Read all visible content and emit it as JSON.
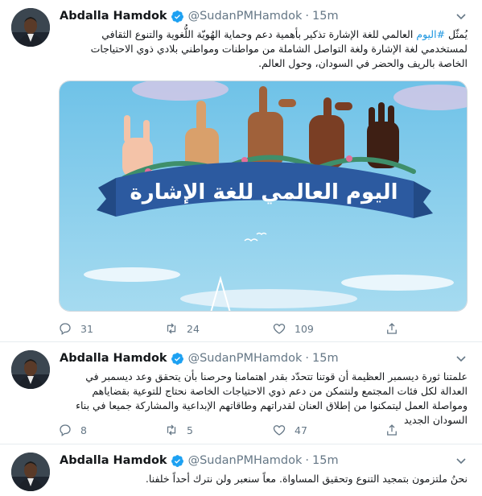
{
  "tweets": [
    {
      "author": "Abdalla Hamdok",
      "handle": "@SudanPMHamdok",
      "separator": "·",
      "time": "15m",
      "hashtag": "#اليوم",
      "text_before": "يُمثّل",
      "text_after": "العالمي للغة الإشارة تذكير بأهمية دعم وحماية الهُويّة اللُّغوية والتنوع الثقافي لمستخدمي لغة الإشارة ولغة التواصل الشاملة من مواطنات ومواطني بلادي ذوي الاحتياجات الخاصة بالريف والحضر في السودان، وحول العالم.",
      "media_caption": "اليوم العالمي للغة الإشارة",
      "replies": "31",
      "retweets": "24",
      "likes": "109"
    },
    {
      "author": "Abdalla Hamdok",
      "handle": "@SudanPMHamdok",
      "separator": "·",
      "time": "15m",
      "text": "علمتنا ثورة ديسمبر العظيمة أن قوتنا تتحدّد بقدر اهتمامنا وحرصنا بأن يتحقق وعد ديسمبر في العدالة لكل فئات المجتمع ولنتمكن من دعم ذوي الاحتياجات الخاصة نحتاج للتوعية بقضاياهم ومواصلة العمل ليتمكنوا من إطلاق العنان لقدراتهم وطاقاتهم الإبداعية والمشاركة جميعا في بناء السودان الجديد",
      "replies": "8",
      "retweets": "5",
      "likes": "47"
    },
    {
      "author": "Abdalla Hamdok",
      "handle": "@SudanPMHamdok",
      "separator": "·",
      "time": "15m",
      "text": "نحنُ ملتزمون بتمجيد التنوع وتحقيق المساواة. معاً سنعبر ولن نترك أحداً خلفنا."
    }
  ],
  "colors": {
    "link": "#1b95e0",
    "verified": "#1da1f2",
    "muted": "#657786",
    "banner": "#2c5aa0",
    "sky": "#8fcdea"
  },
  "icons": [
    "verified-badge-icon",
    "chevron-down-icon",
    "reply-icon",
    "retweet-icon",
    "like-icon",
    "share-icon"
  ]
}
